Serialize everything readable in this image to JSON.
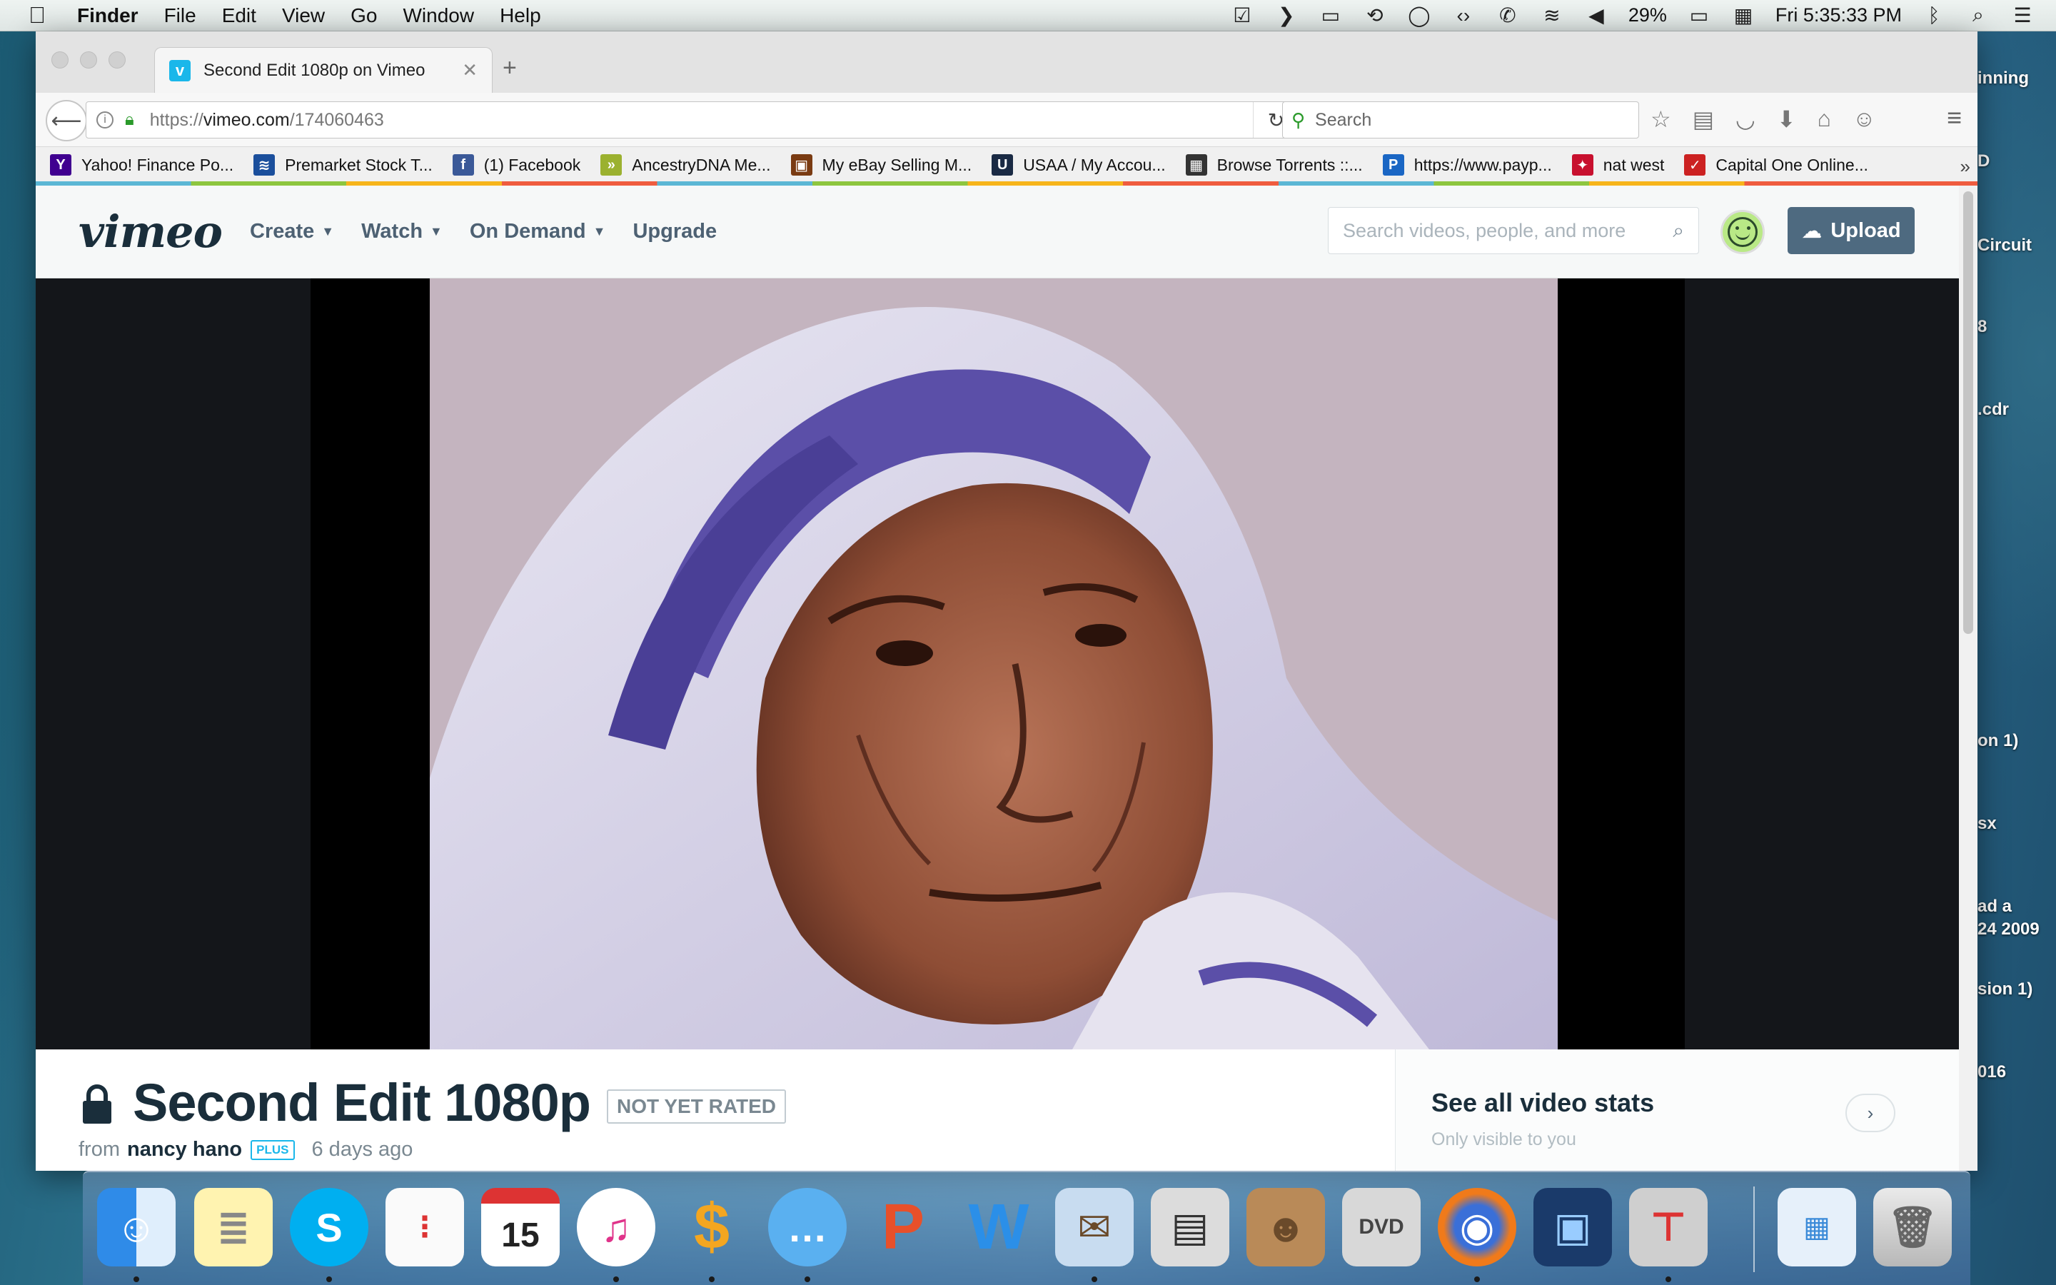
{
  "menubar": {
    "app": "Finder",
    "items": [
      "File",
      "Edit",
      "View",
      "Go",
      "Window",
      "Help"
    ],
    "battery": "29%",
    "clock": "Fri 5:35:33 PM"
  },
  "desktop": {
    "labels": [
      "inning",
      "D",
      "Circuit",
      "8",
      ".cdr",
      "on 1)",
      "sx",
      "ad a",
      "24 2009",
      "sion 1)",
      "016"
    ]
  },
  "browser": {
    "tab_title": "Second Edit 1080p on Vimeo",
    "url_prefix": "https://",
    "url_host": "vimeo.com",
    "url_path": "/174060463",
    "search_placeholder": "Search",
    "bookmarks": [
      {
        "label": "Yahoo! Finance Po...",
        "icon": "Y",
        "color": "#400090"
      },
      {
        "label": "Premarket Stock T...",
        "icon": "≋",
        "color": "#1b4f9c"
      },
      {
        "label": "(1) Facebook",
        "icon": "f",
        "color": "#3b5998"
      },
      {
        "label": "AncestryDNA Me...",
        "icon": "»",
        "color": "#9bb12f"
      },
      {
        "label": "My eBay Selling M...",
        "icon": "▣",
        "color": "#7a3b12"
      },
      {
        "label": "USAA / My Accou...",
        "icon": "U",
        "color": "#1a2a44"
      },
      {
        "label": "Browse Torrents ::...",
        "icon": "▦",
        "color": "#333333"
      },
      {
        "label": "https://www.payp...",
        "icon": "P",
        "color": "#1a66c4"
      },
      {
        "label": "nat west",
        "icon": "✦",
        "color": "#c8102e"
      },
      {
        "label": "Capital One Online...",
        "icon": "✓",
        "color": "#cc2222"
      }
    ]
  },
  "vimeo": {
    "logo": "vimeo",
    "nav": [
      {
        "label": "Create",
        "dropdown": true
      },
      {
        "label": "Watch",
        "dropdown": true
      },
      {
        "label": "On Demand",
        "dropdown": true
      },
      {
        "label": "Upgrade",
        "dropdown": false
      }
    ],
    "search_placeholder": "Search videos, people, and more",
    "upload_label": "Upload",
    "video": {
      "title": "Second Edit 1080p",
      "rating": "NOT YET RATED",
      "from_label": "from",
      "owner": "nancy hano",
      "badge": "PLUS",
      "uploaded": "6 days ago"
    },
    "stats": {
      "title": "See all video stats",
      "subtitle": "Only visible to you"
    }
  },
  "colors": {
    "vimeo_blue": "#1ab7ea",
    "vimeo_dark": "#1a2e3b",
    "nav_text": "#4d6173",
    "upload_bg": "#4e6a80"
  }
}
